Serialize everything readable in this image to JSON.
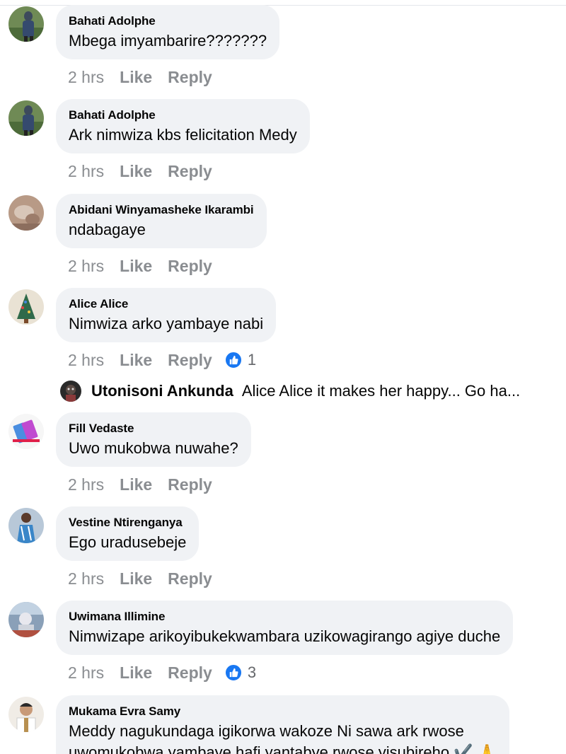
{
  "comments": [
    {
      "author": "Bahati Adolphe",
      "text": "Mbega imyambarire???????",
      "time": "2 hrs",
      "like": "Like",
      "reply": "Reply"
    },
    {
      "author": "Bahati Adolphe",
      "text": "Ark nimwiza kbs felicitation Medy",
      "time": "2 hrs",
      "like": "Like",
      "reply": "Reply"
    },
    {
      "author": "Abidani Winyamasheke Ikarambi",
      "text": "ndabagaye",
      "time": "2 hrs",
      "like": "Like",
      "reply": "Reply"
    },
    {
      "author": "Alice Alice",
      "text": "Nimwiza arko yambaye nabi",
      "time": "2 hrs",
      "like": "Like",
      "reply": "Reply",
      "reactions": "1"
    },
    {
      "author": "Fill Vedaste",
      "text": "Uwo mukobwa nuwahe?",
      "time": "2 hrs",
      "like": "Like",
      "reply": "Reply"
    },
    {
      "author": "Vestine Ntirenganya",
      "text": "Ego uradusebeje",
      "time": "2 hrs",
      "like": "Like",
      "reply": "Reply"
    },
    {
      "author": "Uwimana Illimine",
      "text": "Nimwizape arikoyibukekwambara uzikowagirango agiye duche",
      "time": "2 hrs",
      "like": "Like",
      "reply": "Reply",
      "reactions": "3"
    },
    {
      "author": "Mukama Evra Samy",
      "text": "Meddy nagukundaga igikorwa wakoze Ni sawa ark rwose",
      "text2": "uwomukobwa yambaye hafi yantabye rwose yisubireho ✔️ 🙏"
    }
  ],
  "reply_preview": {
    "author": "Utonisoni Ankunda",
    "text": "Alice Alice it makes her happy... Go ha..."
  },
  "colors": {
    "bubble": "#f0f2f5",
    "meta": "#8a8d91",
    "like_blue": "#1877f2"
  },
  "icons": {
    "reaction": "thumbs-up-icon"
  }
}
